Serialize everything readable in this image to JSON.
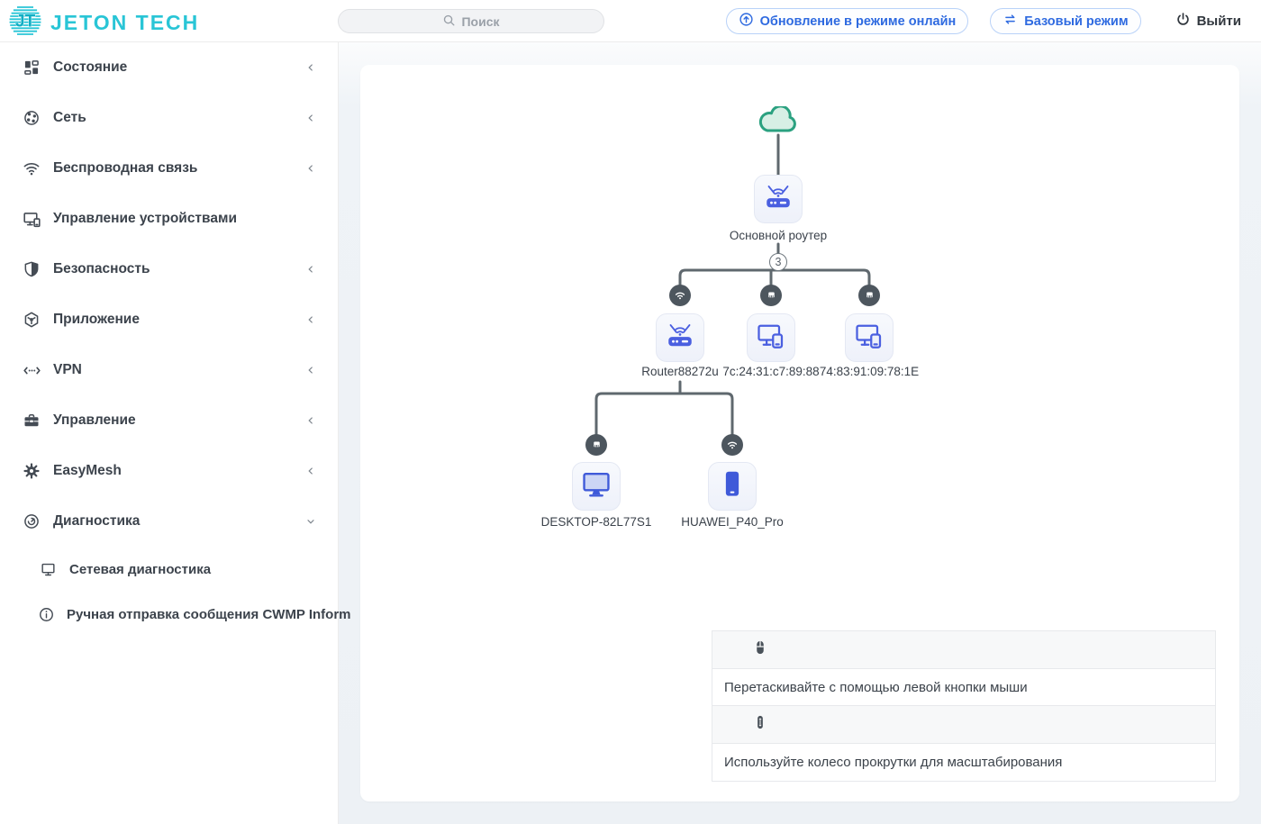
{
  "topbar": {
    "logo_text": "JETON TECH",
    "search_placeholder": "Поиск",
    "update_button": "Обновление в режиме онлайн",
    "basic_mode_button": "Базовый режим",
    "logout_label": "Выйти"
  },
  "sidebar": {
    "items": [
      {
        "label": "Состояние",
        "icon": "dashboard-icon",
        "chevron": "left"
      },
      {
        "label": "Сеть",
        "icon": "network-icon",
        "chevron": "left"
      },
      {
        "label": "Беспроводная связь",
        "icon": "wifi-icon",
        "chevron": "left"
      },
      {
        "label": "Управление устройствами",
        "icon": "devices-icon",
        "chevron": "none"
      },
      {
        "label": "Безопасность",
        "icon": "shield-icon",
        "chevron": "left"
      },
      {
        "label": "Приложение",
        "icon": "app-icon",
        "chevron": "left"
      },
      {
        "label": "VPN",
        "icon": "vpn-icon",
        "chevron": "left"
      },
      {
        "label": "Управление",
        "icon": "toolbox-icon",
        "chevron": "left"
      },
      {
        "label": "EasyMesh",
        "icon": "gear-icon",
        "chevron": "left"
      },
      {
        "label": "Диагностика",
        "icon": "gauge-icon",
        "chevron": "down",
        "expanded": true
      }
    ],
    "subitems": [
      {
        "label": "Сетевая диагностика",
        "icon": "monitor-icon"
      },
      {
        "label": "Ручная отправка сообщения CWMP Inform",
        "icon": "info-icon"
      }
    ]
  },
  "topology": {
    "root_label": "Основной роутер",
    "badge": "3",
    "level2": [
      {
        "label": "Router88272u",
        "type": "router",
        "link": "wifi"
      },
      {
        "label": "7c:24:31:c7:89:88",
        "type": "device",
        "link": "ethernet"
      },
      {
        "label": "74:83:91:09:78:1E",
        "type": "device",
        "link": "ethernet"
      }
    ],
    "level3": [
      {
        "label": "DESKTOP-82L77S1",
        "type": "desktop",
        "link": "ethernet"
      },
      {
        "label": "HUAWEI_P40_Pro",
        "type": "phone",
        "link": "wifi"
      }
    ]
  },
  "legend": {
    "drag_text": "Перетаскивайте с помощью левой кнопки мыши",
    "scroll_text": "Используйте колесо прокрутки для масштабирования"
  },
  "colors": {
    "brand_cyan": "#29c5d6",
    "accent_blue": "#2e6ae0",
    "node_blue": "#4a5fe0",
    "cloud_green": "#2ba180",
    "line_gray": "#5f686e",
    "dot_gray": "#4d565e"
  }
}
